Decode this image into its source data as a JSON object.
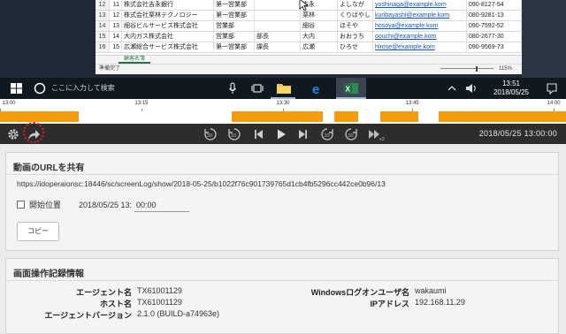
{
  "screen": {
    "rows": [
      {
        "rownum": "12",
        "no": "11",
        "company": "株式会社吉永銀行",
        "dept": "第一営業部",
        "role": "",
        "surname": "吉永",
        "kana": "よしなが",
        "email": "yoshinaga@example.kom",
        "phone": "090-8127-54"
      },
      {
        "rownum": "13",
        "no": "12",
        "company": "株式会社栗林テクノロジー",
        "dept": "第一営業部",
        "role": "",
        "surname": "栗林",
        "kana": "くりばやし",
        "email": "kuribayashi@example.kom",
        "phone": "080-9281-13"
      },
      {
        "rownum": "14",
        "no": "13",
        "company": "細谷ビルサービス株式会社",
        "dept": "営業部",
        "role": "",
        "surname": "細谷",
        "kana": "ほそや",
        "email": "hosoya@example.kom",
        "phone": "090-7592-52"
      },
      {
        "rownum": "15",
        "no": "14",
        "company": "大内ガス株式会社",
        "dept": "営業部",
        "role": "部長",
        "surname": "大内",
        "kana": "おおうち",
        "email": "oouchi@example.kom",
        "phone": "080-2677-30"
      },
      {
        "rownum": "16",
        "no": "15",
        "company": "広瀬総合サービス株式会社",
        "dept": "第一営業部",
        "role": "課長",
        "surname": "広瀬",
        "kana": "ひろせ",
        "email": "hirose@example.kom",
        "phone": "090-9569-73"
      }
    ],
    "sheet_tab": "顧客名簿",
    "status_ready": "準備完了",
    "zoom": "115%",
    "taskbar": {
      "search_placeholder": "ここに入力して検索",
      "clock_time": "13:51",
      "clock_date": "2018/05/25",
      "icons": [
        "windows-icon",
        "search-icon",
        "mic-icon",
        "task-view-icon",
        "folder-icon",
        "edge-icon",
        "excel-icon",
        "chevron-up-icon",
        "speaker-icon",
        "notification-icon"
      ]
    }
  },
  "timeline": {
    "total_minutes": 60,
    "ticks": [
      {
        "label": "13:00",
        "minute": 0
      },
      {
        "label": "13:15",
        "minute": 15
      },
      {
        "label": "13:30",
        "minute": 30
      },
      {
        "label": "13:45",
        "minute": 43.7
      },
      {
        "label": "14:00",
        "minute": 58.7
      }
    ],
    "active_segments": [
      [
        0,
        8.3
      ],
      [
        24.6,
        34.2
      ],
      [
        35.4,
        38.0
      ],
      [
        40.3,
        44.3
      ],
      [
        46.5,
        60
      ]
    ],
    "active_color": "#f39c12"
  },
  "controls": {
    "buttons": [
      "settings",
      "share",
      "rewind-30",
      "rewind-10",
      "skip-previous",
      "play",
      "skip-next",
      "forward-10",
      "forward-30",
      "speed-x2"
    ],
    "current_time": "2018/05/25 13:00:00"
  },
  "share": {
    "title": "動画のURLを共有",
    "url": "https://idoperaionsc:18446/sc/screenLog/show/2018-05-25/b1022f76c901739765d1cb4fb5296cc442ce0b96/13",
    "start_label": "開始位置",
    "start_date": "2018/05/25 13:",
    "start_time": "00:00",
    "copy_label": "コピー"
  },
  "info": {
    "title": "画面操作記録情報",
    "agent_name_label": "エージェント名",
    "agent_name": "TX61001129",
    "host_label": "ホスト名",
    "host": "TX61001129",
    "version_label": "エージェントバージョン",
    "version": "2.1.0 (BUILD-a74963e)",
    "logon_user_label": "Windowsログオンユーザ名",
    "logon_user": "wakaumi",
    "ip_label": "IPアドレス",
    "ip": "192.168.11.29"
  }
}
